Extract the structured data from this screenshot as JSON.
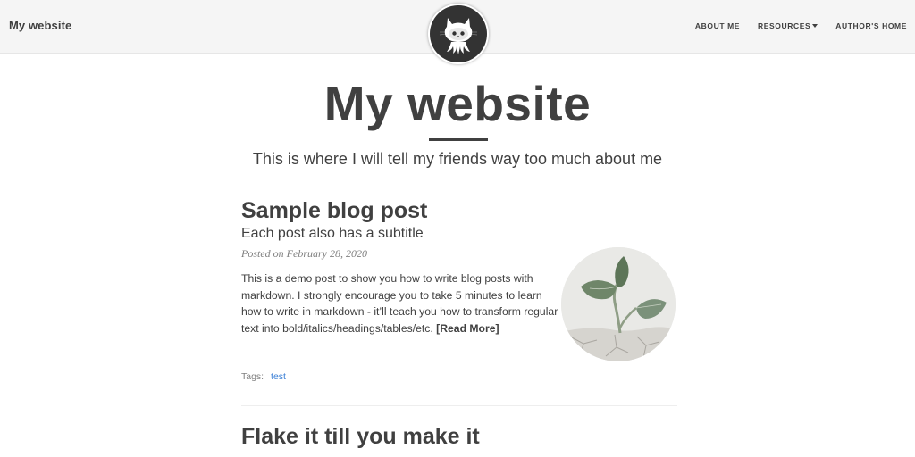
{
  "navbar": {
    "brand": "My website",
    "links": [
      {
        "label": "About Me"
      },
      {
        "label": "Resources"
      },
      {
        "label": "Author's home"
      }
    ],
    "avatar_icon": "github-octocat-icon"
  },
  "header": {
    "title": "My website",
    "subtitle": "This is where I will tell my friends way too much about me"
  },
  "posts": [
    {
      "title": "Sample blog post",
      "subtitle": "Each post also has a subtitle",
      "meta": "Posted on February 28, 2020",
      "excerpt": "This is a demo post to show you how to write blog posts with markdown. I strongly encourage you to take 5 minutes to learn how to write in markdown - it’ll teach you how to transform regular text into bold/italics/headings/tables/etc.",
      "read_more": "[Read More]",
      "tags_label": "Tags:",
      "tags": [
        "test"
      ],
      "thumbnail": "plant-sprout-image"
    },
    {
      "title": "Flake it till you make it"
    }
  ],
  "colors": {
    "navbar_bg": "#f5f5f5",
    "text": "#404040",
    "tag_link": "#3a7fd6",
    "meta": "#808080"
  }
}
